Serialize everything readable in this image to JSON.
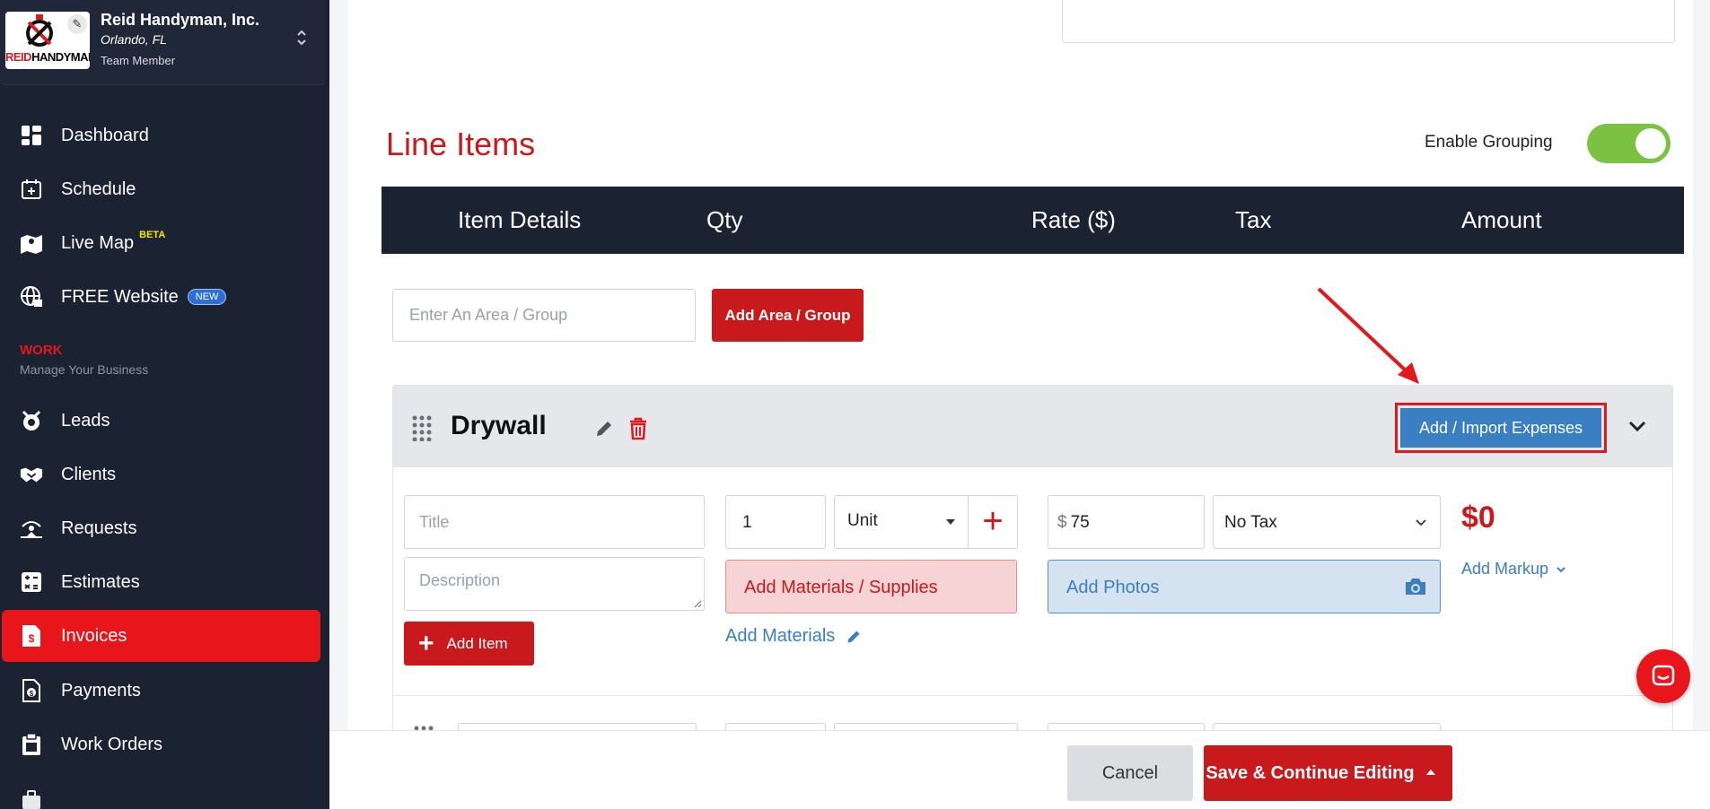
{
  "company": {
    "name": "Reid Handyman, Inc.",
    "location": "Orlando, FL",
    "role": "Team Member",
    "logo_text_red": "REID",
    "logo_text_black": "HANDYMAN"
  },
  "nav": {
    "items": [
      {
        "label": "Dashboard",
        "icon": "dashboard-icon"
      },
      {
        "label": "Schedule",
        "icon": "calendar-icon"
      },
      {
        "label": "Live Map",
        "icon": "map-icon",
        "badge": "BETA"
      },
      {
        "label": "FREE Website",
        "icon": "globe-icon",
        "badge": "NEW"
      },
      {
        "label": "Leads",
        "icon": "leads-icon"
      },
      {
        "label": "Clients",
        "icon": "handshake-icon"
      },
      {
        "label": "Requests",
        "icon": "requests-icon"
      },
      {
        "label": "Estimates",
        "icon": "calculator-icon"
      },
      {
        "label": "Invoices",
        "icon": "invoice-icon",
        "active": true
      },
      {
        "label": "Payments",
        "icon": "payments-icon"
      },
      {
        "label": "Work Orders",
        "icon": "clipboard-icon"
      }
    ],
    "section_title": "WORK",
    "section_subtitle": "Manage Your Business"
  },
  "line_items": {
    "title": "Line Items",
    "grouping_label": "Enable Grouping",
    "grouping_enabled": true,
    "columns": [
      "Item Details",
      "Qty",
      "Rate ($)",
      "Tax",
      "Amount"
    ],
    "area_placeholder": "Enter An Area / Group",
    "add_area_label": "Add Area / Group",
    "group": {
      "name": "Drywall",
      "import_label": "Add / Import Expenses",
      "item": {
        "title_placeholder": "Title",
        "description_placeholder": "Description",
        "qty": "1",
        "unit": "Unit",
        "currency": "$",
        "rate": "75",
        "tax": "No Tax",
        "materials_label": "Add Materials / Supplies",
        "add_materials_link": "Add Materials",
        "photos_label": "Add Photos",
        "amount": "$0",
        "markup_link": "Add Markup",
        "add_item_label": "Add Item"
      }
    }
  },
  "footer": {
    "cancel_label": "Cancel",
    "save_label": "Save & Continue Editing"
  },
  "colors": {
    "brand_red": "#c8191c",
    "sidebar_bg": "#1b2232",
    "accent_blue": "#3a7fc2",
    "toggle_green": "#7bc142"
  }
}
